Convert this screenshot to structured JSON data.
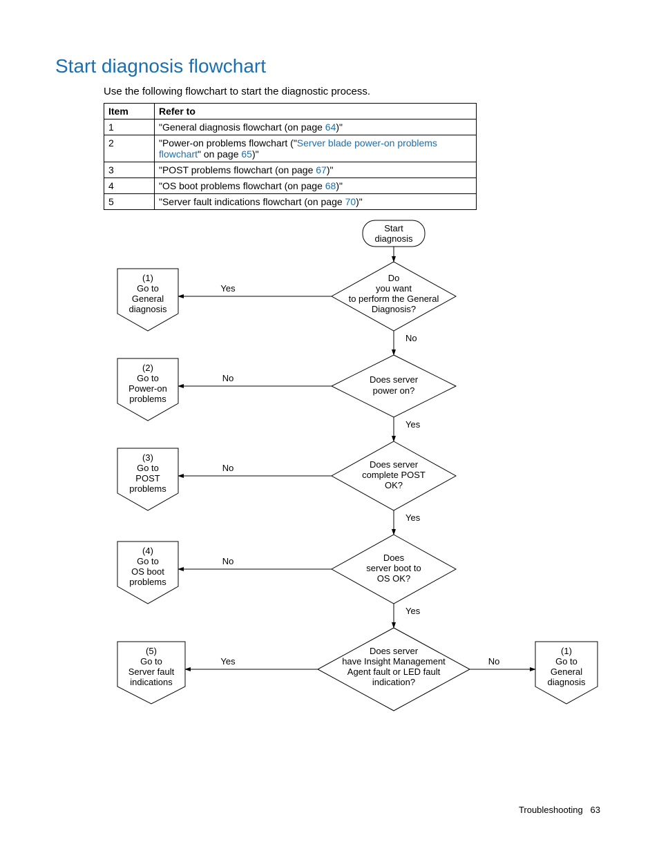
{
  "title": "Start diagnosis flowchart",
  "intro": "Use the following flowchart to start the diagnostic process.",
  "table": {
    "headers": {
      "col1": "Item",
      "col2": "Refer to"
    },
    "rows": [
      {
        "item": "1",
        "pre": "\"General diagnosis flowchart (on page ",
        "link": "64",
        "post": ")\""
      },
      {
        "item": "2",
        "pre": "\"Power-on problems flowchart (\"",
        "link": "Server blade power-on problems flowchart",
        "mid": "\" on page ",
        "link2": "65",
        "post": ")\""
      },
      {
        "item": "3",
        "pre": "\"POST problems flowchart (on page ",
        "link": "67",
        "post": ")\""
      },
      {
        "item": "4",
        "pre": "\"OS boot problems flowchart (on page ",
        "link": "68",
        "post": ")\""
      },
      {
        "item": "5",
        "pre": "\"Server fault indications flowchart (on page ",
        "link": "70",
        "post": ")\""
      }
    ]
  },
  "flow": {
    "start": {
      "l1": "Start",
      "l2": "diagnosis"
    },
    "d1": {
      "l1": "Do",
      "l2": "you want",
      "l3": "to perform the General",
      "l4": "Diagnosis?",
      "yes": "Yes",
      "no": "No"
    },
    "d2": {
      "l1": "Does server",
      "l2": "power on?",
      "yes": "Yes",
      "no": "No"
    },
    "d3": {
      "l1": "Does server",
      "l2": "complete POST",
      "l3": "OK?",
      "yes": "Yes",
      "no": "No"
    },
    "d4": {
      "l1": "Does",
      "l2": "server boot to",
      "l3": "OS OK?",
      "yes": "Yes",
      "no": "No"
    },
    "d5": {
      "l1": "Does server",
      "l2": "have Insight Management",
      "l3": "Agent fault or LED fault",
      "l4": "indication?",
      "yes": "Yes",
      "no": "No"
    },
    "off1": {
      "l1": "(1)",
      "l2": "Go to",
      "l3": "General",
      "l4": "diagnosis"
    },
    "off2": {
      "l1": "(2)",
      "l2": "Go to",
      "l3": "Power-on",
      "l4": "problems"
    },
    "off3": {
      "l1": "(3)",
      "l2": "Go to",
      "l3": "POST",
      "l4": "problems"
    },
    "off4": {
      "l1": "(4)",
      "l2": "Go to",
      "l3": "OS boot",
      "l4": "problems"
    },
    "off5": {
      "l1": "(5)",
      "l2": "Go to",
      "l3": "Server fault",
      "l4": "indications"
    },
    "off6": {
      "l1": "(1)",
      "l2": "Go to",
      "l3": "General",
      "l4": "diagnosis"
    }
  },
  "footer": {
    "section": "Troubleshooting",
    "page": "63"
  }
}
